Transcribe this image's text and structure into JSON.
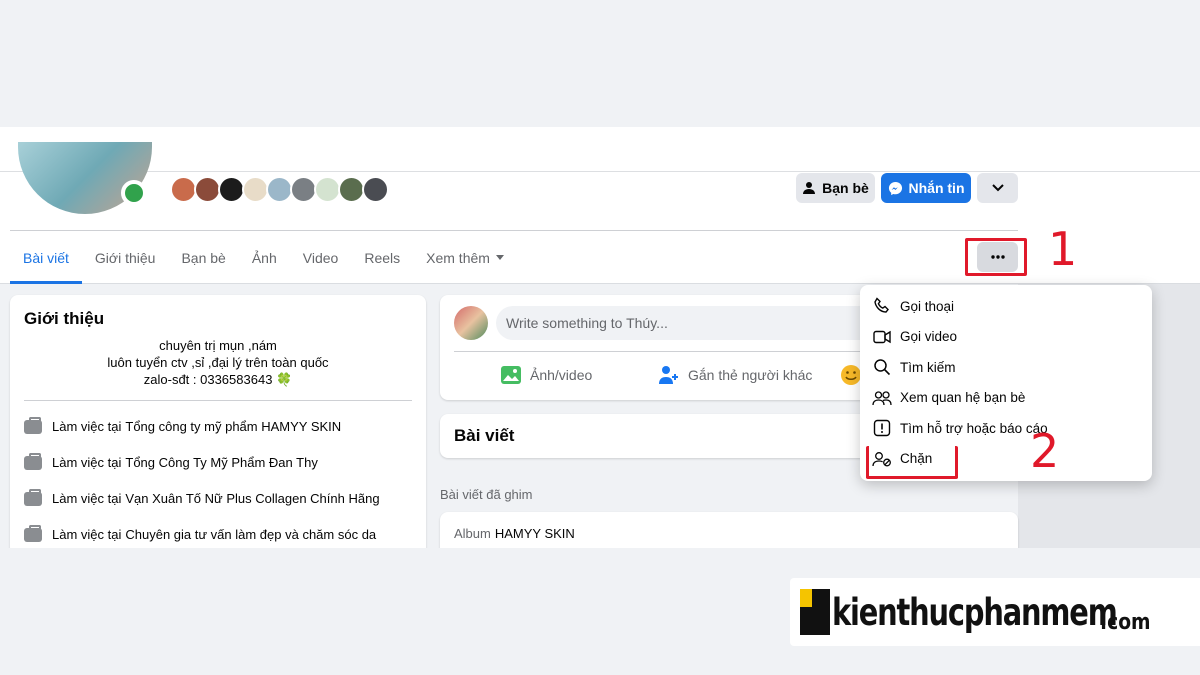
{
  "profile": {
    "friend_button": "Bạn bè",
    "message_button": "Nhắn tin"
  },
  "tabs": [
    {
      "label": "Bài viết",
      "active": true
    },
    {
      "label": "Giới thiệu"
    },
    {
      "label": "Bạn bè"
    },
    {
      "label": "Ảnh"
    },
    {
      "label": "Video"
    },
    {
      "label": "Reels"
    },
    {
      "label": "Xem thêm"
    }
  ],
  "intro": {
    "title": "Giới thiệu",
    "bio_lines": [
      "chuyên trị mụn ,nám",
      "luôn tuyển ctv ,sỉ ,đại lý trên toàn quốc",
      "zalo-sđt : 0336583643 🍀"
    ],
    "work_prefix": "Làm việc tại",
    "work": [
      "Tổng công ty mỹ phẩm HAMYY SKIN",
      "Tổng Công Ty Mỹ Phẩm Đan Thy",
      "Vạn Xuân Tố Nữ Plus Collagen Chính Hãng",
      "Chuyên gia tư vấn làm đẹp và chăm sóc da"
    ]
  },
  "composer": {
    "placeholder": "Write something to Thúy...",
    "action_photo": "Ảnh/video",
    "action_tag": "Gắn thẻ người khác"
  },
  "posts": {
    "title": "Bài viết",
    "pinned_label": "Bài viết đã ghim",
    "album_prefix": "Album",
    "album_name": "HAMYY SKIN"
  },
  "menu": {
    "items": [
      "Gọi thoại",
      "Gọi video",
      "Tìm kiếm",
      "Xem quan hệ bạn bè",
      "Tìm hỗ trợ hoặc báo cáo",
      "Chặn"
    ],
    "icons": [
      "phone-icon",
      "video-camera-icon",
      "search-icon",
      "friends-icon",
      "report-icon",
      "block-user-icon"
    ]
  },
  "annotations": {
    "step1": "1",
    "step2": "2"
  },
  "watermark": {
    "main": "kienthucphanmem",
    "suffix": ".com"
  },
  "colors": {
    "accent": "#1b74e4",
    "annotation": "#e0192a",
    "online": "#31a24c"
  }
}
